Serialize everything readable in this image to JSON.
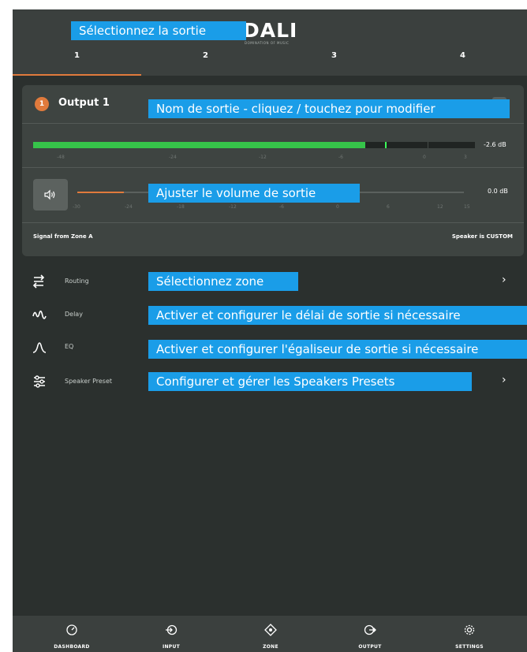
{
  "header": {
    "logo": "DALI",
    "logo_sub": "DOMINATION OF MUSIC",
    "tabs": [
      "1",
      "2",
      "3",
      "4"
    ],
    "active_tab": "1"
  },
  "output": {
    "number": "1",
    "name": "Output 1",
    "meter": {
      "level_db": -2.6,
      "level_label": "-2.6 dB",
      "fill_fraction": 0.752,
      "peak_fraction": 0.797,
      "ticks": [
        "-48",
        "-24",
        "-12",
        "-6",
        "0",
        "3"
      ]
    },
    "volume": {
      "value_label": "0.0 dB",
      "fill_fraction": 0.12,
      "ticks": [
        "-30",
        "-24",
        "-18",
        "-12",
        "-6",
        "0",
        "6",
        "12",
        "15"
      ]
    },
    "signal": "Signal from Zone A",
    "speaker": "Speaker is CUSTOM"
  },
  "menu": [
    {
      "label": "Routing",
      "icon": "routing-icon",
      "chevron": "›"
    },
    {
      "label": "Delay",
      "icon": "delay-icon",
      "chevron": ""
    },
    {
      "label": "EQ",
      "icon": "eq-icon",
      "chevron": ""
    },
    {
      "label": "Speaker Preset",
      "icon": "speaker-preset-icon",
      "chevron": "›"
    }
  ],
  "callouts": {
    "select_output": "Sélectionnez la sortie",
    "output_name": "Nom de sortie - cliquez / touchez pour modifier",
    "volume": "Ajuster le volume de sortie",
    "zone": "Sélectionnez zone",
    "delay": "Activer et configurer le délai de sortie si nécessaire",
    "eq": "Activer et configurer l'égaliseur de sortie si nécessaire",
    "presets": "Configurer et gérer les Speakers Presets"
  },
  "nav": [
    {
      "label": "DASHBOARD",
      "icon": "dashboard-icon"
    },
    {
      "label": "INPUT",
      "icon": "input-icon"
    },
    {
      "label": "ZONE",
      "icon": "zone-icon"
    },
    {
      "label": "OUTPUT",
      "icon": "output-icon"
    },
    {
      "label": "SETTINGS",
      "icon": "settings-icon"
    }
  ],
  "colors": {
    "accent": "#e07a3c",
    "callout": "#1a9de8",
    "meter": "#36c44a",
    "background": "#2b302e"
  }
}
